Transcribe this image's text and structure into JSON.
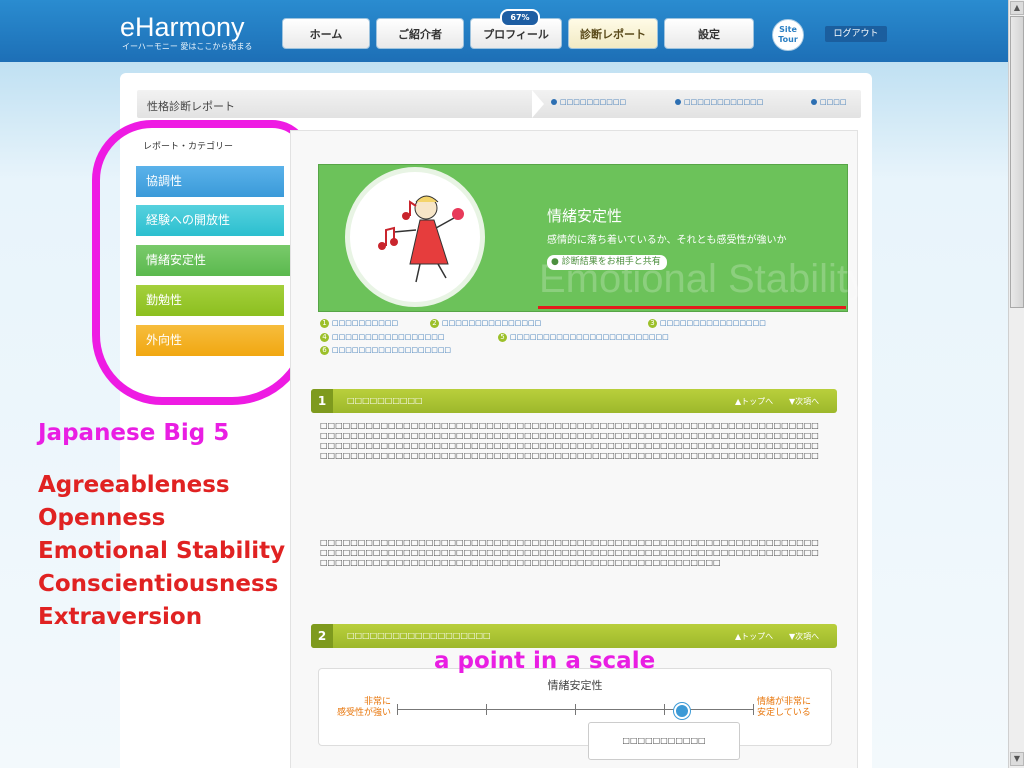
{
  "header": {
    "logo": "eHarmony",
    "logo_sub": "イーハーモニー  愛はここから始まる",
    "nav": [
      {
        "label": "ホーム"
      },
      {
        "label": "ご紹介者"
      },
      {
        "label": "プロフィール"
      },
      {
        "label": "診断レポート"
      },
      {
        "label": "設定"
      }
    ],
    "profile_badge": "67%",
    "site_tour": "Site Tour",
    "logout": "ログアウト"
  },
  "breadcrumb": {
    "title": "性格診断レポート",
    "links": [
      "□□□□□□□□□□",
      "□□□□□□□□□□□□",
      "□□□□"
    ]
  },
  "sidebar": {
    "label": "レポート・カテゴリー",
    "items": [
      {
        "label": "協調性",
        "color": "#3a9ad9"
      },
      {
        "label": "経験への開放性",
        "color": "#2bbfcf"
      },
      {
        "label": "情緒安定性",
        "color": "#5bb94e"
      },
      {
        "label": "勤勉性",
        "color": "#8cbf1f"
      },
      {
        "label": "外向性",
        "color": "#f1a711"
      }
    ]
  },
  "hero": {
    "title": "情緒安定性",
    "subtitle": "感情的に落ち着いているか、それとも感受性が強いか",
    "share": "診断結果をお相手と共有",
    "watermark": "Emotional Stability",
    "color": "#6cc25a"
  },
  "toc": [
    {
      "num": "1",
      "text": "□□□□□□□□□□"
    },
    {
      "num": "2",
      "text": "□□□□□□□□□□□□□□□"
    },
    {
      "num": "3",
      "text": "□□□□□□□□□□□□□□□□"
    },
    {
      "num": "4",
      "text": "□□□□□□□□□□□□□□□□□"
    },
    {
      "num": "5",
      "text": "□□□□□□□□□□□□□□□□□□□□□□□□"
    },
    {
      "num": "6",
      "text": "□□□□□□□□□□□□□□□□□□"
    }
  ],
  "sections": [
    {
      "num": "1",
      "title": "□□□□□□□□□□",
      "top": "トップへ",
      "next": "次項へ"
    },
    {
      "num": "2",
      "title": "□□□□□□□□□□□□□□□□□□□",
      "top": "トップへ",
      "next": "次項へ"
    }
  ],
  "paragraphs": [
    "□□□□□□□□□□□□□□□□□□□□□□□□□□□□□□□□□□□□□□□□□□□□□□□□□□□□□□□□□□□□□□□□□□□□□□□□□□□□□□□□□□□□□□□□□□□□□□□□□□□□□□□□□□□□□□□□□□□□□□□□□□□□□□□□□□□□□□□□□□□□□□□□□□□□□□□□□□□□□□□□□□□□□□□□□□□□□□□□□□□□□□□□□□□□□□□□□□□□□□□□□□□□□□□□□□□□□□□□□□□□□□□□□□□□□□□□□□□□□□□□□□□□□□□□□□□□□□□□□□□□□□□□",
    "□□□□□□□□□□□□□□□□□□□□□□□□□□□□□□□□□□□□□□□□□□□□□□□□□□□□□□□□□□□□□□□□□□□□□□□□□□□□□□□□□□□□□□□□□□□□□□□□□□□□□□□□□□□□□□□□□□□□□□□□□□□□□□□□□□□□□□□□□□□□□□□□□□□□□□□□□□□□□□□□□□□□□□□□□□□□□□□□□□□□□□□□□"
  ],
  "scale": {
    "title": "情緒安定性",
    "left_label": "非常に\n感受性が強い",
    "right_label": "情緒が非常に\n安定している",
    "tooltip": "□□□□□□□□□□□",
    "value": 0.8
  },
  "annotations": {
    "heading": "Japanese Big 5",
    "traits": [
      "Agreeableness",
      "Openness",
      "Emotional Stability",
      "Conscientiousness",
      "Extraversion"
    ],
    "scale_note": "a point in a scale",
    "highlight_color": "#ee1be3",
    "trait_color": "#e02222"
  }
}
